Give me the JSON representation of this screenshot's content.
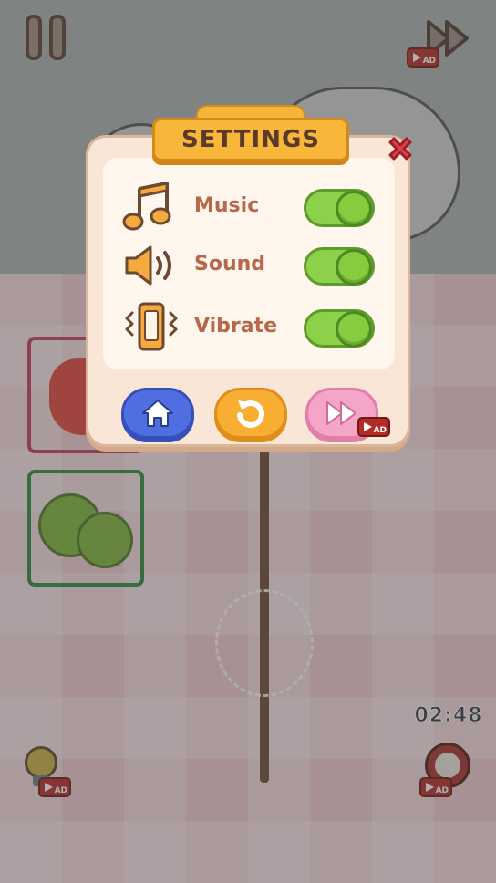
{
  "settings": {
    "title": "SETTINGS",
    "rows": [
      {
        "label": "Music",
        "icon": "music-note-icon",
        "enabled": true
      },
      {
        "label": "Sound",
        "icon": "speaker-icon",
        "enabled": true
      },
      {
        "label": "Vibrate",
        "icon": "vibrate-phone-icon",
        "enabled": true
      }
    ],
    "actions": [
      {
        "icon": "home-icon"
      },
      {
        "icon": "restart-icon"
      },
      {
        "icon": "fast-forward-icon",
        "ad_label": "AD"
      }
    ]
  },
  "hud": {
    "timer": "02:48",
    "skip_ad_label": "AD",
    "hint_ad_label": "AD",
    "clock_ad_label": "AD"
  },
  "colors": {
    "toggle_on": "#8dd04a",
    "title_bar": "#f8b63a",
    "label_text": "#b8674a",
    "home_button": "#4f6ee0",
    "restart_button": "#f7ae33",
    "skip_button": "#f5a5c8",
    "close_button": "#e0404a"
  }
}
